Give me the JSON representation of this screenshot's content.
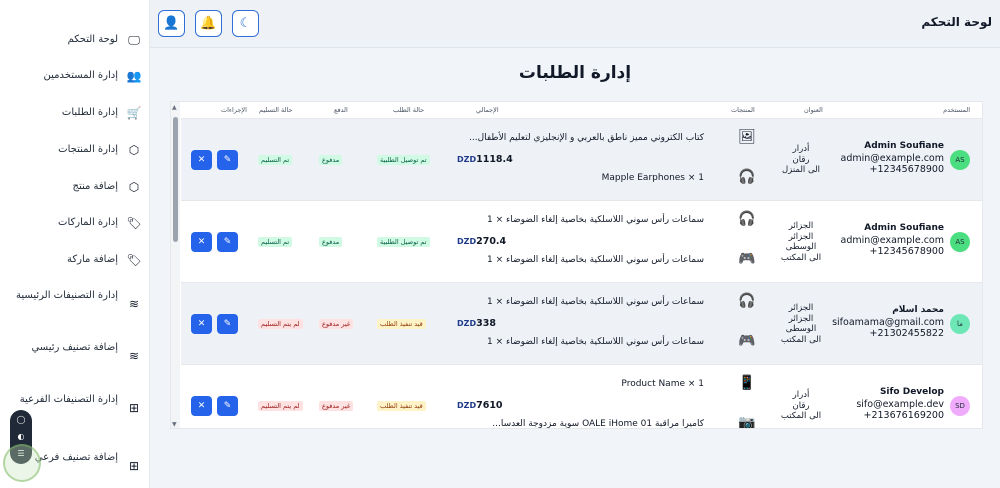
{
  "header": {
    "title": "لوحة التحكم",
    "buttons": [
      {
        "icon": "user-icon",
        "glyph": "👤"
      },
      {
        "icon": "bell-icon",
        "glyph": "🔔"
      },
      {
        "icon": "moon-icon",
        "glyph": "☾"
      }
    ]
  },
  "sidebar": {
    "items": [
      {
        "label": "لوحة التحكم",
        "icon": "monitor-icon",
        "glyph": "🖵"
      },
      {
        "label": "إدارة المستخدمين",
        "icon": "users-icon",
        "glyph": "👥"
      },
      {
        "label": "إدارة الطلبات",
        "icon": "cart-icon",
        "glyph": "🛒"
      },
      {
        "label": "إدارة المنتجات",
        "icon": "box-icon",
        "glyph": "⬡"
      },
      {
        "label": "إضافة منتج",
        "icon": "box-plus-icon",
        "glyph": "⬡"
      },
      {
        "label": "إدارة الماركات",
        "icon": "tag-icon",
        "glyph": "🏷"
      },
      {
        "label": "إضافة ماركة",
        "icon": "tag-plus-icon",
        "glyph": "🏷"
      },
      {
        "label": "إدارة التصنيفات الرئيسية",
        "icon": "layers-icon",
        "glyph": "≋"
      },
      {
        "label": "إضافة تصنيف رئيسي",
        "icon": "layers-plus-icon",
        "glyph": "≋"
      },
      {
        "label": "إدارة التصنيفات الفرعية",
        "icon": "square-plus-icon",
        "glyph": "⊞"
      },
      {
        "label": "إضافة تصنيف فرعي",
        "icon": "square-plus-icon",
        "glyph": "⊞"
      }
    ]
  },
  "page": {
    "title": "إدارة الطلبات"
  },
  "table": {
    "headers": {
      "user": "المستخدم",
      "address": "العنوان",
      "products": "المنتجات",
      "total": "الإجمالي",
      "order_status": "حالة الطلب",
      "payment": "الدفع",
      "delivery": "حالة التسليم",
      "actions": "الإجراءات"
    },
    "rows": [
      {
        "avatar": "AS",
        "avatar_color": "#4ade80",
        "name": "Admin Soufiane",
        "email": "admin@example.com",
        "phone": "+12345678900",
        "address": [
          "أدرار",
          "رقان",
          "الى المنزل"
        ],
        "products": [
          "كتاب الكتروني مميز ناطق بالعربي و الإنجليزي لتعليم الأطفال...",
          "Mapple Earphones × 1"
        ],
        "product_icons": [
          "🖼",
          "🎧"
        ],
        "total": "1118.4",
        "currency": "DZD",
        "order_status": "تم توصيل الطلبية",
        "order_status_color": "green",
        "payment": "مدفوع",
        "payment_color": "green",
        "delivery": "تم التسليم",
        "delivery_color": "green"
      },
      {
        "avatar": "AS",
        "avatar_color": "#4ade80",
        "name": "Admin Soufiane",
        "email": "admin@example.com",
        "phone": "+12345678900",
        "address": [
          "الجزائر",
          "الجزائر",
          "الوسطى",
          "الى المكتب"
        ],
        "products": [
          "سماعات رأس سوني اللاسلكية بخاصية إلغاء الضوضاء × 1",
          "سماعات رأس سوني اللاسلكية بخاصية إلغاء الضوضاء × 1"
        ],
        "product_icons": [
          "🎧",
          "🎮"
        ],
        "total": "270.4",
        "currency": "DZD",
        "order_status": "تم توصيل الطلبية",
        "order_status_color": "green",
        "payment": "مدفوع",
        "payment_color": "green",
        "delivery": "تم التسليم",
        "delivery_color": "green"
      },
      {
        "avatar": "ما",
        "avatar_color": "#6ee7b7",
        "name": "محمد اسلام",
        "email": "sifoamama@gmail.com",
        "phone": "+21302455822",
        "address": [
          "الجزائر",
          "الجزائر",
          "الوسطى",
          "الى المكتب"
        ],
        "products": [
          "سماعات رأس سوني اللاسلكية بخاصية إلغاء الضوضاء × 1",
          "سماعات رأس سوني اللاسلكية بخاصية إلغاء الضوضاء × 1"
        ],
        "product_icons": [
          "🎧",
          "🎮"
        ],
        "total": "338",
        "currency": "DZD",
        "order_status": "قيد تنفيذ الطلب",
        "order_status_color": "yellow",
        "payment": "غير مدفوع",
        "payment_color": "red",
        "delivery": "لم يتم التسليم",
        "delivery_color": "red"
      },
      {
        "avatar": "SD",
        "avatar_color": "#f0abfc",
        "name": "Sifo Develop",
        "email": "sifo@example.dev",
        "phone": "+213676169200",
        "address": [
          "أدرار",
          "رقان",
          "الى المكتب"
        ],
        "products": [
          "Product Name × 1",
          "كاميرا مراقبة OALE iHome 01 سوية مزدوجة العدسا..."
        ],
        "product_icons": [
          "📱",
          "📷"
        ],
        "total": "7610",
        "currency": "DZD",
        "order_status": "قيد تنفيذ الطلب",
        "order_status_color": "yellow",
        "payment": "غير مدفوع",
        "payment_color": "red",
        "delivery": "لم يتم التسليم",
        "delivery_color": "red"
      }
    ],
    "action_edit_glyph": "✎",
    "action_delete_glyph": "✕"
  }
}
